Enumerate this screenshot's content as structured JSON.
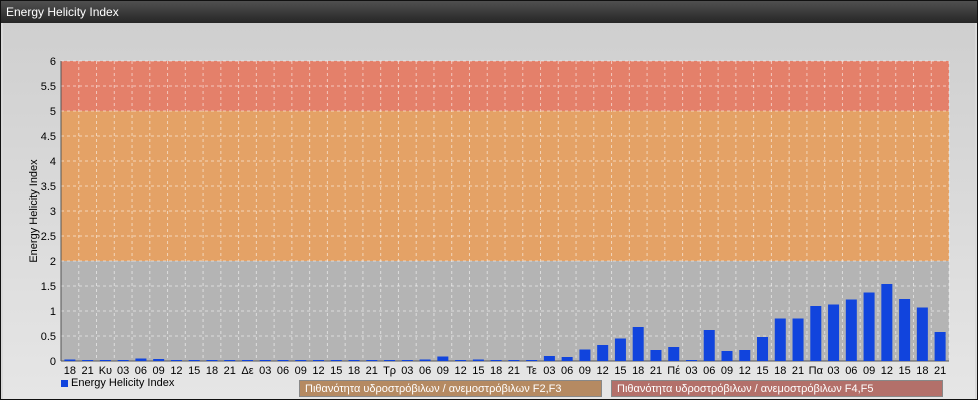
{
  "window": {
    "title": "Energy Helicity Index"
  },
  "chart_data": {
    "type": "bar",
    "ylabel": "Energy Helicity Index",
    "ylim": [
      0,
      6
    ],
    "yticks": [
      0,
      0.5,
      1,
      1.5,
      2,
      2.5,
      3,
      3.5,
      4,
      4.5,
      5,
      5.5,
      6
    ],
    "categories": [
      "18",
      "21",
      "Κυ",
      "03",
      "06",
      "09",
      "12",
      "15",
      "18",
      "21",
      "Δε",
      "03",
      "06",
      "09",
      "12",
      "15",
      "18",
      "21",
      "Τρ",
      "03",
      "06",
      "09",
      "12",
      "15",
      "18",
      "21",
      "Τε",
      "03",
      "06",
      "09",
      "12",
      "15",
      "18",
      "21",
      "Πέ",
      "03",
      "06",
      "09",
      "12",
      "15",
      "18",
      "21",
      "Πα",
      "03",
      "06",
      "09",
      "12",
      "15",
      "18",
      "21"
    ],
    "series": [
      {
        "name": "Energy Helicity Index",
        "color": "#1144dd",
        "values": [
          0.03,
          0.02,
          0.02,
          0.02,
          0.05,
          0.04,
          0.02,
          0.02,
          0.02,
          0.02,
          0.02,
          0.02,
          0.02,
          0.02,
          0.02,
          0.02,
          0.02,
          0.02,
          0.02,
          0.02,
          0.03,
          0.09,
          0.02,
          0.03,
          0.02,
          0.02,
          0.02,
          0.1,
          0.08,
          0.23,
          0.32,
          0.45,
          0.68,
          0.22,
          0.28,
          0.02,
          0.62,
          0.2,
          0.22,
          0.48,
          0.85,
          0.85,
          1.1,
          1.13,
          1.23,
          1.37,
          1.54,
          1.24,
          1.07,
          0.58
        ]
      }
    ],
    "bands": [
      {
        "from": 0,
        "to": 2,
        "color": "#b4b4b4"
      },
      {
        "from": 2,
        "to": 5,
        "color": "#e4a266"
      },
      {
        "from": 5,
        "to": 6,
        "color": "#e4806a"
      }
    ],
    "band_legend": [
      {
        "label": "Πιθανότητα υδροστρόβιλων / ανεμοστρόβιλων F2,F3",
        "color": "#b58a62"
      },
      {
        "label": "Πιθανότητα υδροστρόβιλων / ανεμοστρόβιλων F4,F5",
        "color": "#b3706a"
      }
    ],
    "grid": true,
    "legend": "bottom-left"
  }
}
